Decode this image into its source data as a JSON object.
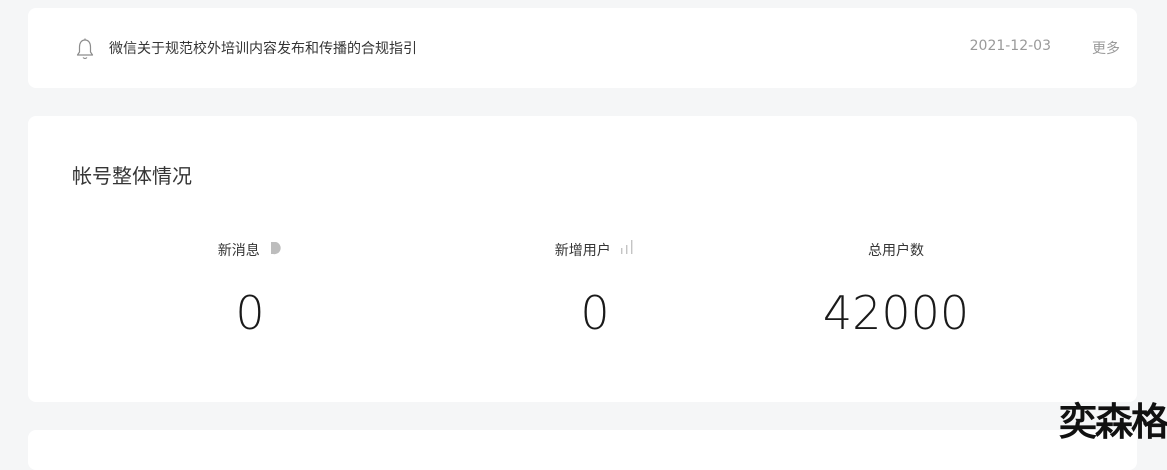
{
  "notice": {
    "title": "微信关于规范校外培训内容发布和传播的合规指引",
    "date": "2021-12-03",
    "more_label": "更多"
  },
  "overview": {
    "title": "帐号整体情况",
    "stats": [
      {
        "label": "新消息",
        "value": "0",
        "icon": "pie-icon"
      },
      {
        "label": "新增用户",
        "value": "0",
        "icon": "bar-chart-icon"
      },
      {
        "label": "总用户数",
        "value": "42000"
      }
    ]
  },
  "watermark": "奕森格"
}
